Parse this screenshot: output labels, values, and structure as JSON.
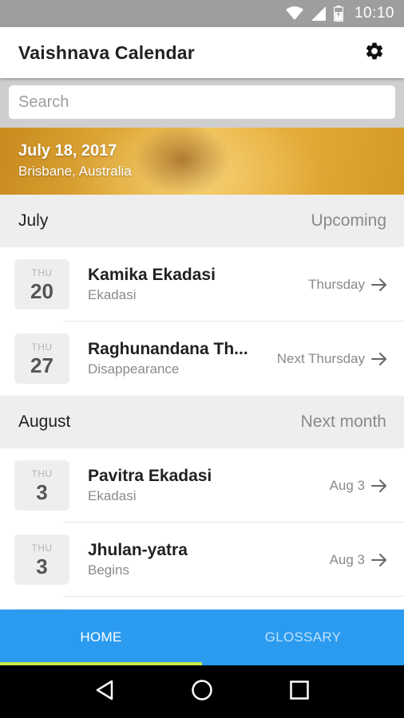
{
  "status_bar": {
    "time": "10:10"
  },
  "app_bar": {
    "title": "Vaishnava Calendar",
    "settings_icon": "gear-icon"
  },
  "search": {
    "placeholder": "Search",
    "value": ""
  },
  "banner": {
    "date": "July 18, 2017",
    "location": "Brisbane, Australia"
  },
  "sections": [
    {
      "month": "July",
      "note": "Upcoming",
      "events": [
        {
          "dow": "THU",
          "day": "20",
          "name": "Kamika Ekadasi",
          "type": "Ekadasi",
          "when": "Thursday"
        },
        {
          "dow": "THU",
          "day": "27",
          "name": "Raghunandana Th...",
          "type": "Disappearance",
          "when": "Next Thursday"
        }
      ]
    },
    {
      "month": "August",
      "note": "Next month",
      "events": [
        {
          "dow": "THU",
          "day": "3",
          "name": "Pavitra Ekadasi",
          "type": "Ekadasi",
          "when": "Aug 3"
        },
        {
          "dow": "THU",
          "day": "3",
          "name": "Jhulan-yatra",
          "type": "Begins",
          "when": "Aug 3"
        }
      ]
    }
  ],
  "tabs": [
    {
      "label": "HOME",
      "active": true
    },
    {
      "label": "GLOSSARY",
      "active": false
    }
  ],
  "colors": {
    "tab_bar": "#2b9bf0",
    "tab_indicator": "#c6e84a",
    "status_bar": "#9e9e9e"
  }
}
